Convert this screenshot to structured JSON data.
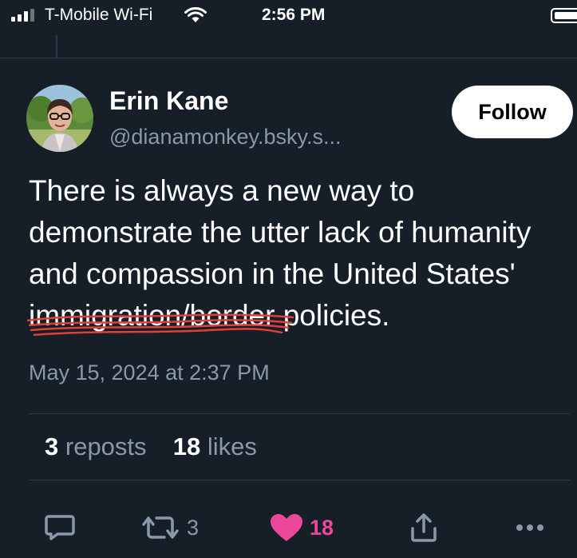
{
  "status_bar": {
    "carrier": "T-Mobile Wi-Fi",
    "time": "2:56 PM"
  },
  "post": {
    "author_name": "Erin Kane",
    "author_handle": "@dianamonkey.bsky.s...",
    "follow_label": "Follow",
    "text_lines": [
      "There is always a new way to",
      "demonstrate the utter lack of humanity",
      "and compassion in the United States'"
    ],
    "struck_text": "immigration/border",
    "text_after_struck": " policies.",
    "timestamp": "May 15, 2024 at 2:37 PM",
    "reposts_count": "3",
    "reposts_label": "reposts",
    "likes_count": "18",
    "likes_label": "likes"
  },
  "actions": {
    "reply_icon": "speech-bubble-icon",
    "repost_icon": "repost-arrows-icon",
    "repost_count": "3",
    "like_icon": "heart-icon",
    "like_count": "18",
    "share_icon": "share-icon",
    "more_icon": "ellipsis-icon"
  },
  "colors": {
    "background": "#161e27",
    "secondary_text": "#8899aa",
    "like": "#ec4899",
    "scribble": "#e0403a"
  }
}
